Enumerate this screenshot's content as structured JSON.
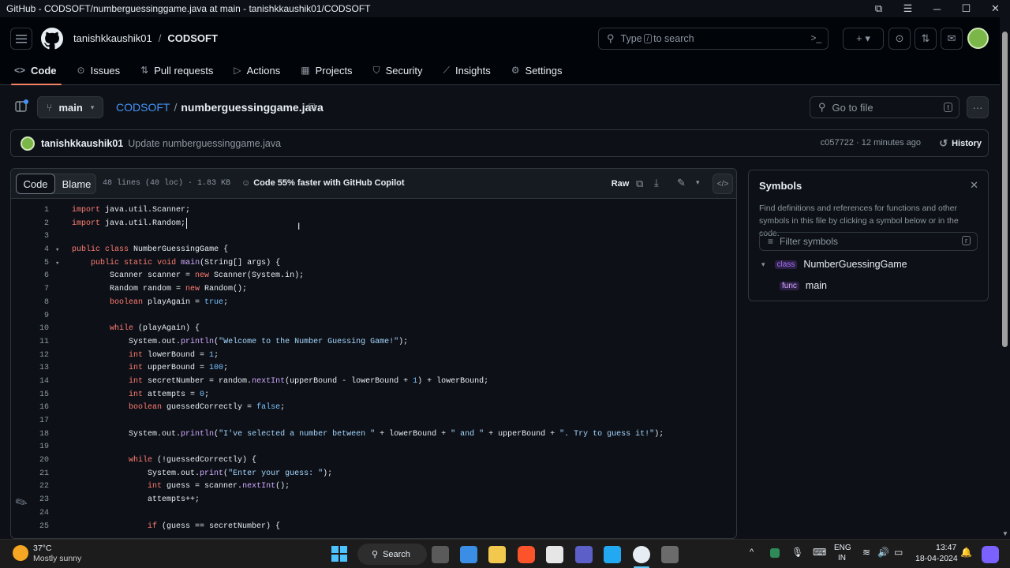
{
  "window": {
    "title": "GitHub - CODSOFT/numberguessinggame.java at main - tanishkkaushik01/CODSOFT",
    "controls": [
      "⧉",
      "☰",
      "─",
      "☐",
      "✕"
    ]
  },
  "header": {
    "owner": "tanishkkaushik01",
    "separator": "/",
    "repo": "CODSOFT",
    "search_placeholder_pre": "Type",
    "search_key": "/",
    "search_placeholder_post": "to search"
  },
  "nav": {
    "tabs": [
      {
        "label": "Code",
        "icon": "<>"
      },
      {
        "label": "Issues",
        "icon": "⊙"
      },
      {
        "label": "Pull requests",
        "icon": "⇅"
      },
      {
        "label": "Actions",
        "icon": "▷"
      },
      {
        "label": "Projects",
        "icon": "▦"
      },
      {
        "label": "Security",
        "icon": "⛉"
      },
      {
        "label": "Insights",
        "icon": "⟋"
      },
      {
        "label": "Settings",
        "icon": "⚙"
      }
    ]
  },
  "file": {
    "branch": "main",
    "repo_link": "CODSOFT",
    "sep": "/",
    "filename": "numberguessinggame.java",
    "goto_placeholder": "Go to file",
    "goto_key": "t"
  },
  "commit": {
    "author": "tanishkkaushik01",
    "message": "Update numberguessinggame.java",
    "sha_time": "c057722 · 12 minutes ago",
    "history": "History"
  },
  "toolbar": {
    "code_tab": "Code",
    "blame_tab": "Blame",
    "meta": "48 lines (40 loc) · 1.83 KB",
    "copilot": "Code 55% faster with GitHub Copilot",
    "raw": "Raw"
  },
  "code": {
    "lines": [
      {
        "n": "1",
        "t": "import java.util.Scanner;"
      },
      {
        "n": "2",
        "t": "import java.util.Random;"
      },
      {
        "n": "3",
        "t": ""
      },
      {
        "n": "4",
        "t": "public class NumberGuessingGame {",
        "fold": true
      },
      {
        "n": "5",
        "t": "    public static void main(String[] args) {",
        "fold": true
      },
      {
        "n": "6",
        "t": "        Scanner scanner = new Scanner(System.in);"
      },
      {
        "n": "7",
        "t": "        Random random = new Random();"
      },
      {
        "n": "8",
        "t": "        boolean playAgain = true;"
      },
      {
        "n": "9",
        "t": ""
      },
      {
        "n": "10",
        "t": "        while (playAgain) {"
      },
      {
        "n": "11",
        "t": "            System.out.println(\"Welcome to the Number Guessing Game!\");"
      },
      {
        "n": "12",
        "t": "            int lowerBound = 1;"
      },
      {
        "n": "13",
        "t": "            int upperBound = 100;"
      },
      {
        "n": "14",
        "t": "            int secretNumber = random.nextInt(upperBound - lowerBound + 1) + lowerBound;"
      },
      {
        "n": "15",
        "t": "            int attempts = 0;"
      },
      {
        "n": "16",
        "t": "            boolean guessedCorrectly = false;"
      },
      {
        "n": "17",
        "t": ""
      },
      {
        "n": "18",
        "t": "            System.out.println(\"I've selected a number between \" + lowerBound + \" and \" + upperBound + \". Try to guess it!\");"
      },
      {
        "n": "19",
        "t": ""
      },
      {
        "n": "20",
        "t": "            while (!guessedCorrectly) {"
      },
      {
        "n": "21",
        "t": "                System.out.print(\"Enter your guess: \");"
      },
      {
        "n": "22",
        "t": "                int guess = scanner.nextInt();"
      },
      {
        "n": "23",
        "t": "                attempts++;"
      },
      {
        "n": "24",
        "t": ""
      },
      {
        "n": "25",
        "t": "                if (guess == secretNumber) {"
      }
    ]
  },
  "symbols": {
    "title": "Symbols",
    "desc": "Find definitions and references for functions and other symbols in this file by clicking a symbol below or in the code.",
    "filter_placeholder": "Filter symbols",
    "filter_key": "r",
    "items": [
      {
        "kind": "class",
        "name": "NumberGuessingGame"
      },
      {
        "kind": "func",
        "name": "main"
      }
    ]
  },
  "taskbar": {
    "temp": "37°C",
    "weather": "Mostly sunny",
    "search": "Search",
    "lang1": "ENG",
    "lang2": "IN",
    "time": "13:47",
    "date": "18-04-2024"
  },
  "colors": {
    "accent": "#f78166",
    "link": "#4493f8",
    "bg": "#0d1117"
  }
}
